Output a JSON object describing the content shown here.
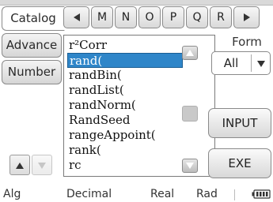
{
  "side_tabs": [
    "Catalog",
    "Advance",
    "Number"
  ],
  "letter_tabs": {
    "prev_icon": "triangle-left-icon",
    "letters": [
      "M",
      "N",
      "O",
      "P",
      "Q",
      "R"
    ],
    "next_icon": "triangle-right-icon"
  },
  "catalog": {
    "items": [
      "r²Corr",
      "rand(",
      "randBin(",
      "randList(",
      "randNorm(",
      "RandSeed",
      "rangeAppoint(",
      "rank(",
      "rc"
    ],
    "selected_index": 1,
    "selected_color": "#2f86c9",
    "scroll_up_icon": "scroll-up-icon",
    "scroll_down_icon": "scroll-down-icon"
  },
  "right_panel": {
    "form_label": "Form",
    "form_value": "All",
    "input_label": "INPUT",
    "exe_label": "EXE"
  },
  "status_bar": {
    "mode": "Alg",
    "number_format": "Decimal",
    "complex": "Real",
    "angle": "Rad",
    "battery_icon": "battery-icon"
  }
}
